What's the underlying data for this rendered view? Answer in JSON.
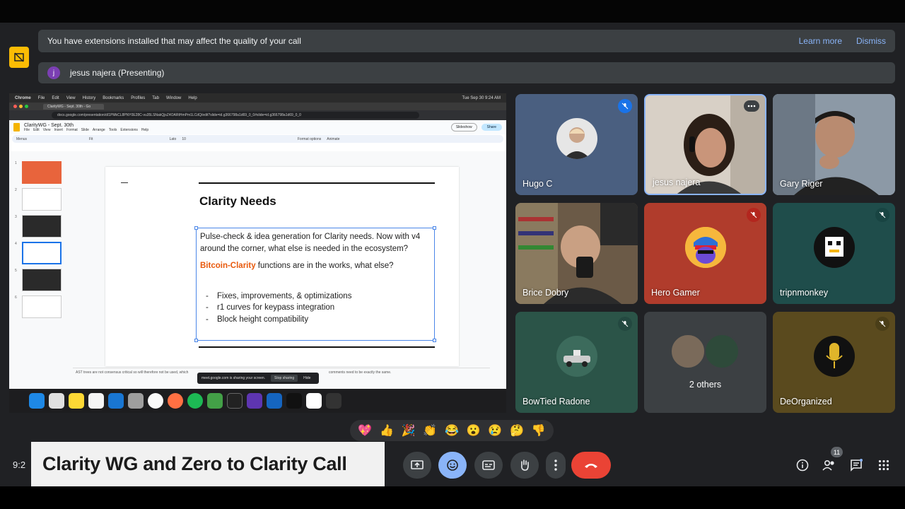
{
  "banner": {
    "message": "You have extensions installed that may affect the quality of your call",
    "learn_more": "Learn more",
    "dismiss": "Dismiss"
  },
  "presenting": {
    "avatar_letter": "j",
    "label": "jesus najera (Presenting)"
  },
  "shared_screen": {
    "menubar": [
      "Chrome",
      "File",
      "Edit",
      "View",
      "History",
      "Bookmarks",
      "Profiles",
      "Tab",
      "Window",
      "Help"
    ],
    "clock": "Tue Sep 30  9:24 AM",
    "tab_title": "ClarityWG - Sept. 30th - Go",
    "url": "docs.google.com/presentation/d/1PMkCL8PNY0E28C-vu35LSNakQjsZ4OARtHmPm1LCdQ/edit?slide=id.g366798a1d69_0_0#slide=id.g366798a1d69_0_0",
    "doc_title": "ClarityWG - Sept. 30th",
    "doc_menu": [
      "File",
      "Edit",
      "View",
      "Insert",
      "Format",
      "Slide",
      "Arrange",
      "Tools",
      "Extensions",
      "Help"
    ],
    "slideshow": "Slideshow",
    "share": "Share",
    "toolbar": [
      "Menus",
      "Fit",
      "Lato",
      "10",
      "Format options",
      "Animate"
    ],
    "slide_numbers": [
      "1",
      "2",
      "3",
      "4",
      "5",
      "6"
    ],
    "slide": {
      "title": "Clarity Needs",
      "para1": "Pulse-check & idea generation for Clarity needs. Now with v4 around the corner, what else is needed in the ecosystem?",
      "highlight": "Bitcoin-Clarity",
      "para2_rest": " functions are in the works, what else?",
      "bullets": [
        "Fixes, improvements, & optimizations",
        "r1 curves for keypass integration",
        "Block height compatibility"
      ]
    },
    "notes": "AST trees are not consensus critical so will therefore not be used, which",
    "notes_end": "comments need to be exactly the same.",
    "sharing_msg": "meet.google.com is sharing your screen.",
    "stop_sharing": "Stop sharing",
    "hide": "Hide"
  },
  "participants": [
    {
      "name": "Hugo C",
      "muted": true
    },
    {
      "name": "jesus najera",
      "muted": false,
      "active": true
    },
    {
      "name": "Gary Riger",
      "muted": false
    },
    {
      "name": "Brice Dobry",
      "muted": false
    },
    {
      "name": "Hero Gamer",
      "muted": true
    },
    {
      "name": "tripnmonkey",
      "muted": true
    },
    {
      "name": "BowTied Radone",
      "muted": true
    },
    {
      "name": "2 others",
      "muted": false
    },
    {
      "name": "DeOrganized",
      "muted": true
    }
  ],
  "reactions": [
    "💖",
    "👍",
    "🎉",
    "👏",
    "😂",
    "😮",
    "😢",
    "🤔",
    "👎"
  ],
  "controls": {
    "clock": "9:2",
    "people_count": "11"
  },
  "overlay_title": "Clarity WG and Zero to Clarity Call",
  "colors": {
    "stage_bg": "#202124",
    "accent_blue": "#8ab4f8",
    "end_call_red": "#ea4335",
    "warning_yellow": "#fbbc04"
  }
}
